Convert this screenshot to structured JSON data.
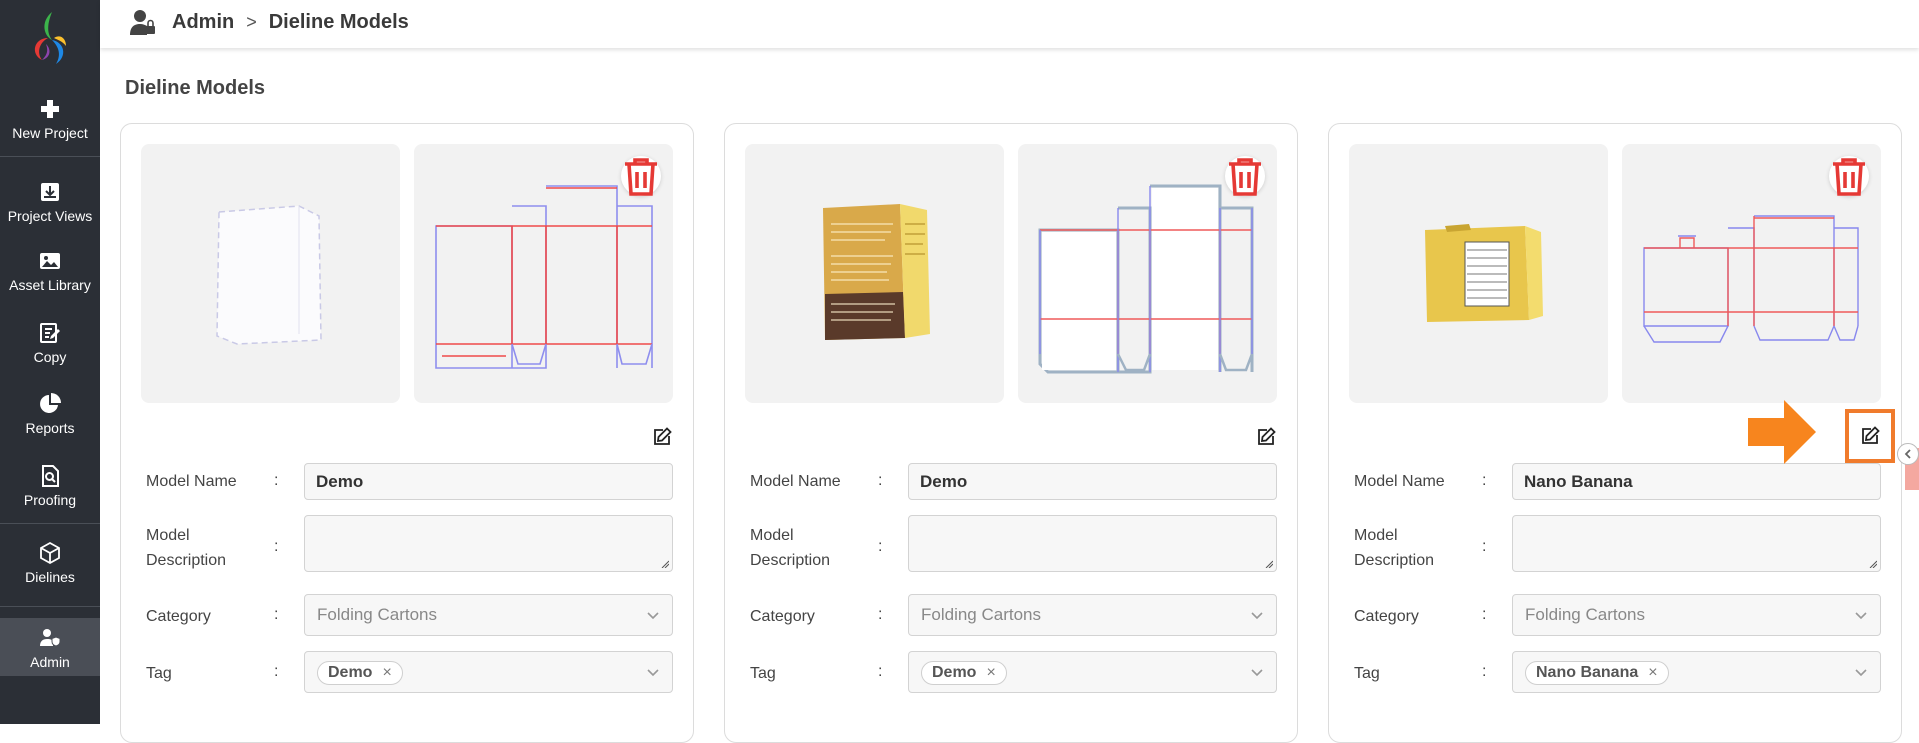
{
  "sidebar": {
    "items": [
      {
        "label": "New Project",
        "icon": "plus-icon"
      },
      {
        "label": "Project Views",
        "icon": "download-box-icon"
      },
      {
        "label": "Asset Library",
        "icon": "image-icon"
      },
      {
        "label": "Copy",
        "icon": "edit-document-icon"
      },
      {
        "label": "Reports",
        "icon": "pie-chart-icon"
      },
      {
        "label": "Proofing",
        "icon": "search-document-icon"
      },
      {
        "label": "Dielines",
        "icon": "box-icon"
      },
      {
        "label": "Admin",
        "icon": "user-shield-icon"
      }
    ]
  },
  "breadcrumb": {
    "root": "Admin",
    "separator": ">",
    "current": "Dieline Models"
  },
  "page": {
    "title": "Dieline Models"
  },
  "labels": {
    "model_name": "Model Name",
    "model_description_1": "Model",
    "model_description_2": "Description",
    "category": "Category",
    "tag": "Tag",
    "colon": ":"
  },
  "cards": [
    {
      "model_name": "Demo",
      "description": "",
      "category": "Folding Cartons",
      "tag": "Demo",
      "tag_remove": "×"
    },
    {
      "model_name": "Demo",
      "description": "",
      "category": "Folding Cartons",
      "tag": "Demo",
      "tag_remove": "×"
    },
    {
      "model_name": "Nano Banana",
      "description": "",
      "category": "Folding Cartons",
      "tag": "Nano Banana",
      "tag_remove": "×"
    }
  ],
  "colors": {
    "sidebar_bg": "#2b2f36",
    "delete_red": "#e53935",
    "highlight_orange": "#f07b2c"
  }
}
